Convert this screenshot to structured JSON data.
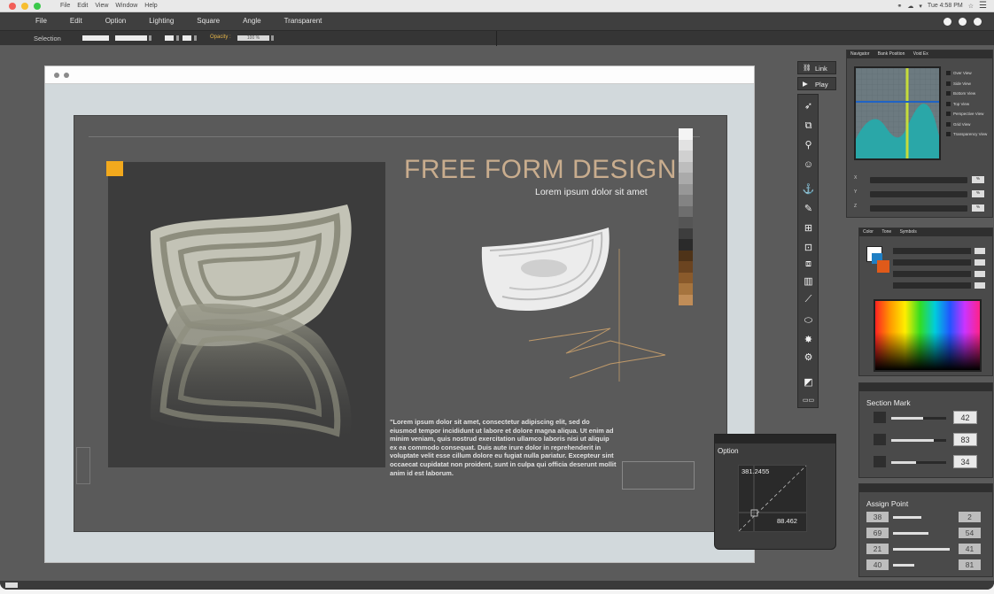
{
  "os": {
    "menu": [
      "File",
      "Edit",
      "View",
      "Window",
      "Help"
    ],
    "clock": "Tue 4:58 PM"
  },
  "app": {
    "menu": [
      "File",
      "Edit",
      "Option",
      "Lighting",
      "Square",
      "Angle",
      "Transparent"
    ],
    "options": {
      "selection_label": "Selection",
      "opacity_label": "Opacity :",
      "opacity_value": "100 %"
    }
  },
  "canvas": {
    "title": "FREE FORM DESIGN",
    "subtitle": "Lorem ipsum dolor sit amet",
    "body": "\"Lorem ipsum dolor sit amet, consectetur adipiscing elit, sed do eiusmod tempor incididunt ut labore et dolore magna aliqua. Ut enim ad minim veniam, quis nostrud exercitation ullamco laboris nisi ut aliquip ex ea commodo consequat. Duis aute irure dolor in reprehenderit in voluptate velit esse cillum dolore eu fugiat nulla pariatur. Excepteur sint occaecat cupidatat non proident, sunt in culpa qui officia deserunt mollit anim id est laborum."
  },
  "tools": {
    "link_label": "Link",
    "play_label": "Play"
  },
  "navigator": {
    "tabs": [
      "Navigator",
      "Bank Position",
      "Void Ex"
    ],
    "views": [
      "Over View",
      "Side View",
      "Bottom View",
      "Top View",
      "Perspective View",
      "Grid View",
      "Transparency View"
    ],
    "axes": [
      "X",
      "Y",
      "Z"
    ],
    "axis_values": [
      "%",
      "%",
      "%"
    ]
  },
  "color_panel": {
    "tabs": [
      "Color",
      "Tone",
      "Symbols"
    ]
  },
  "section_mark": {
    "title": "Section Mark",
    "values": [
      "42",
      "83",
      "34"
    ]
  },
  "assign_point": {
    "title": "Assign Point",
    "rows": [
      {
        "left": "38",
        "right": "2"
      },
      {
        "left": "69",
        "right": "54"
      },
      {
        "left": "21",
        "right": "41"
      },
      {
        "left": "40",
        "right": "81"
      }
    ]
  },
  "option_popup": {
    "label": "Option",
    "value_top": "381.2455",
    "value_bottom": "88.462"
  },
  "colors": {
    "accent": "#f2a91d",
    "title": "#c9ad8e",
    "nav_fill": "#2aa7a8",
    "nav_line_v": "#c6dc3a",
    "nav_line_h": "#1f63c4"
  }
}
